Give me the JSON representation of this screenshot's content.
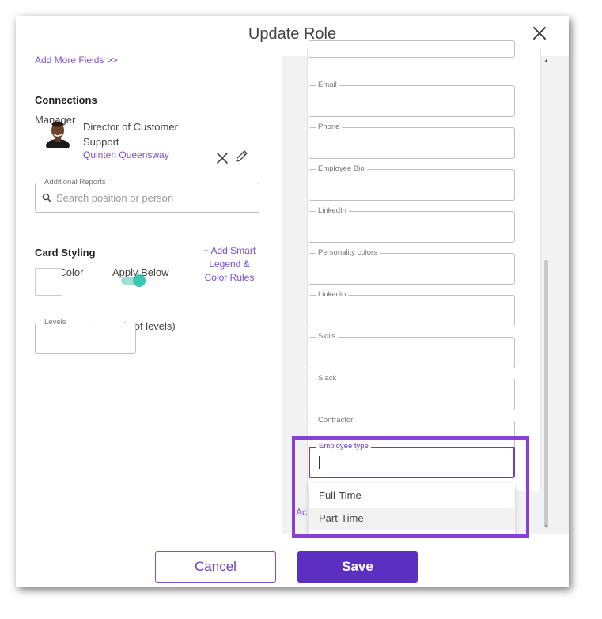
{
  "dialog": {
    "title": "Update Role",
    "close_icon": "close-icon"
  },
  "left": {
    "add_more_fields": "Add More Fields >>",
    "connections_heading": "Connections",
    "manager_label": "Manager",
    "manager": {
      "title": "Director of Customer Support",
      "name": "Quinten Queensway"
    },
    "additional_reports": {
      "legend": "Additional Reports",
      "placeholder": "Search position or person",
      "value": ""
    },
    "card_styling_heading": "Card Styling",
    "role_color_label": "Role Color",
    "apply_below_label": "Apply Below",
    "apply_below_on": true,
    "smart_legend_link": "+ Add Smart Legend & Color Rules",
    "nudge_label": "Nudge Card Down (# of levels)",
    "levels_legend": "Levels",
    "levels_value": ""
  },
  "right": {
    "fields": [
      {
        "label": "Email",
        "value": ""
      },
      {
        "label": "Phone",
        "value": ""
      },
      {
        "label": "Employee Bio",
        "value": ""
      },
      {
        "label": "LinkedIn",
        "value": ""
      },
      {
        "label": "Personality colors",
        "value": ""
      },
      {
        "label": "Linkedin",
        "value": ""
      },
      {
        "label": "Skills",
        "value": ""
      },
      {
        "label": "Slack",
        "value": ""
      },
      {
        "label": "Contractor",
        "value": ""
      }
    ],
    "employee_type": {
      "label": "Employee type",
      "value": "",
      "options": [
        "Full-Time",
        "Part-Time"
      ],
      "hovered_option": "Part-Time"
    },
    "add_fragment": "Ac"
  },
  "footer": {
    "cancel_label": "Cancel",
    "save_label": "Save"
  },
  "colors": {
    "accent": "#5a2fc2",
    "link": "#7a4fd0",
    "toggle_on": "#3cc5b0",
    "highlight": "#8a3ed8"
  }
}
